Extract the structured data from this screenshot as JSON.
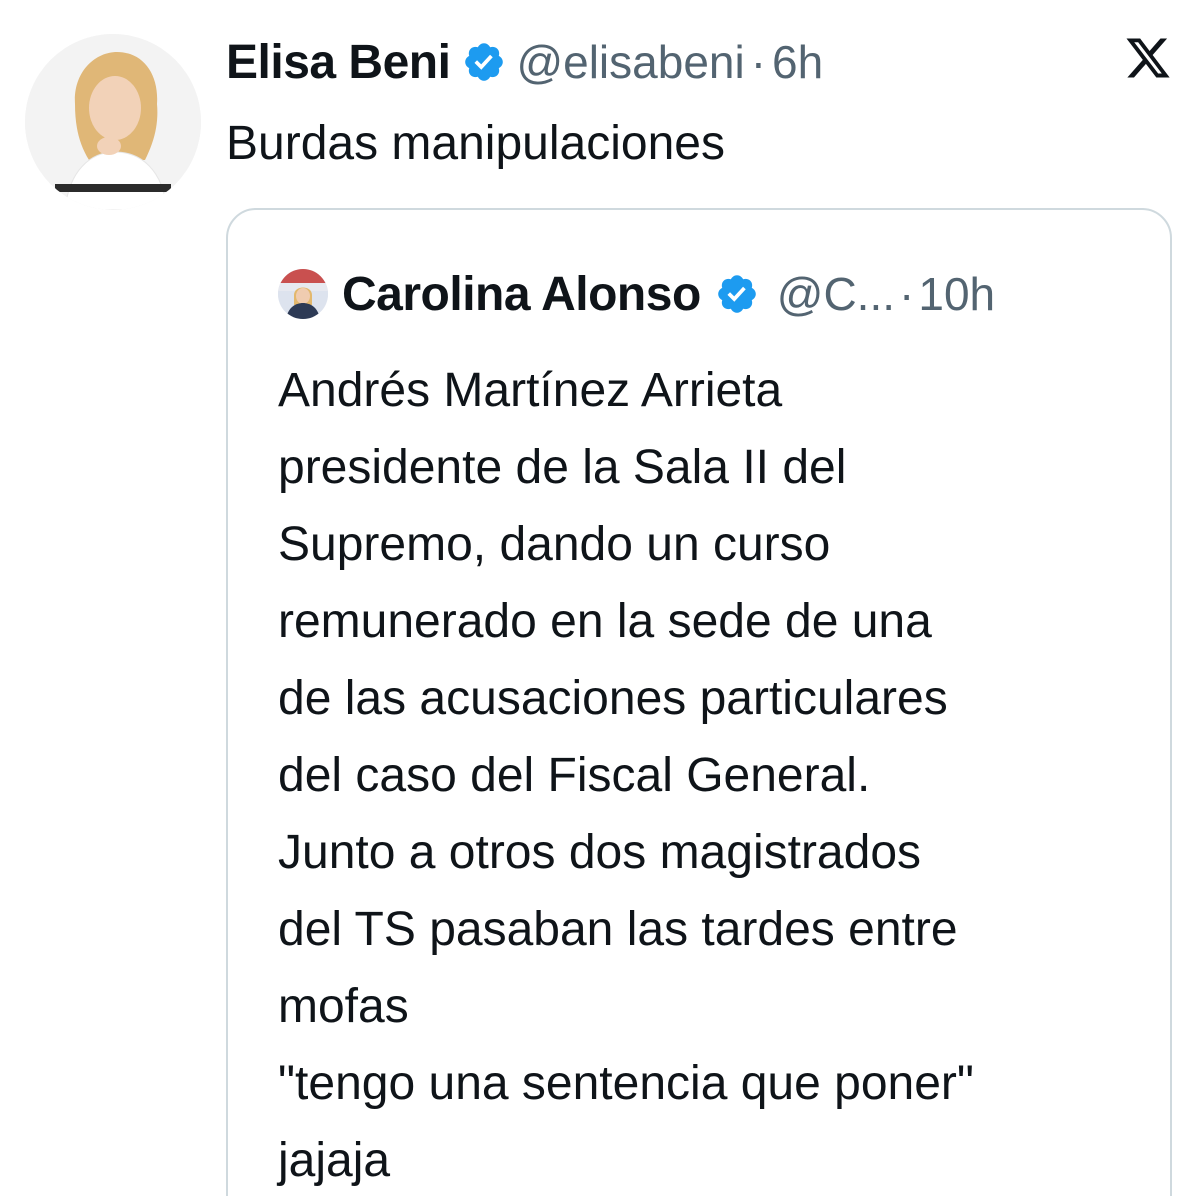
{
  "tweet": {
    "author_name": "Elisa Beni",
    "author_handle": "@elisabeni",
    "separator": "·",
    "time": "6h",
    "text": "Burdas manipulaciones",
    "avatar_icon": "person-photo-icon",
    "verified_icon": "verified-badge-icon",
    "brand_icon": "x-logo-icon"
  },
  "quoted_tweet": {
    "author_name": "Carolina Alonso",
    "author_handle": "@C...",
    "separator": "·",
    "time": "10h",
    "text_lines": [
      "Andrés Martínez Arrieta",
      "presidente de la Sala II del",
      "Supremo, dando un curso",
      "remunerado en la sede de una",
      "de las acusaciones particulares",
      "del caso del Fiscal General.",
      "Junto a otros dos magistrados",
      "del TS pasaban las tardes entre",
      "mofas",
      "\"tengo una sentencia que poner\"",
      "jajaja"
    ]
  },
  "colors": {
    "text": "#0f1419",
    "muted": "#536471",
    "verified": "#1d9bf0",
    "border": "#cfd9de"
  }
}
